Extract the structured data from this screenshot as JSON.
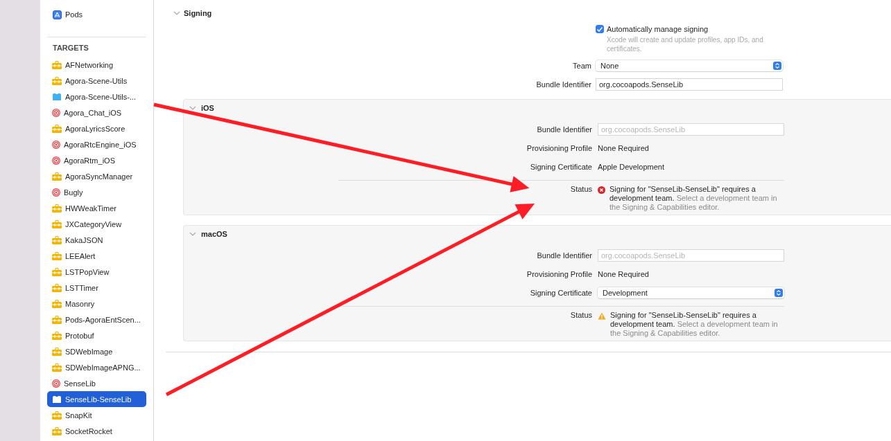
{
  "sidebar": {
    "project": {
      "label": "Pods"
    },
    "section_title": "TARGETS",
    "items": [
      {
        "label": "AFNetworking",
        "kind": "toolbox",
        "selected": false
      },
      {
        "label": "Agora-Scene-Utils",
        "kind": "toolbox",
        "selected": false
      },
      {
        "label": "Agora-Scene-Utils-...",
        "kind": "bundle",
        "selected": false
      },
      {
        "label": "Agora_Chat_iOS",
        "kind": "target",
        "selected": false
      },
      {
        "label": "AgoraLyricsScore",
        "kind": "toolbox",
        "selected": false
      },
      {
        "label": "AgoraRtcEngine_iOS",
        "kind": "target",
        "selected": false
      },
      {
        "label": "AgoraRtm_iOS",
        "kind": "target",
        "selected": false
      },
      {
        "label": "AgoraSyncManager",
        "kind": "toolbox",
        "selected": false
      },
      {
        "label": "Bugly",
        "kind": "target",
        "selected": false
      },
      {
        "label": "HWWeakTimer",
        "kind": "toolbox",
        "selected": false
      },
      {
        "label": "JXCategoryView",
        "kind": "toolbox",
        "selected": false
      },
      {
        "label": "KakaJSON",
        "kind": "toolbox",
        "selected": false
      },
      {
        "label": "LEEAlert",
        "kind": "toolbox",
        "selected": false
      },
      {
        "label": "LSTPopView",
        "kind": "toolbox",
        "selected": false
      },
      {
        "label": "LSTTimer",
        "kind": "toolbox",
        "selected": false
      },
      {
        "label": "Masonry",
        "kind": "toolbox",
        "selected": false
      },
      {
        "label": "Pods-AgoraEntScen...",
        "kind": "toolbox",
        "selected": false
      },
      {
        "label": "Protobuf",
        "kind": "toolbox",
        "selected": false
      },
      {
        "label": "SDWebImage",
        "kind": "toolbox",
        "selected": false
      },
      {
        "label": "SDWebImageAPNG...",
        "kind": "toolbox",
        "selected": false
      },
      {
        "label": "SenseLib",
        "kind": "target",
        "selected": false
      },
      {
        "label": "SenseLib-SenseLib",
        "kind": "bundle",
        "selected": true
      },
      {
        "label": "SnapKit",
        "kind": "toolbox",
        "selected": false
      },
      {
        "label": "SocketRocket",
        "kind": "toolbox",
        "selected": false
      }
    ]
  },
  "signing": {
    "title": "Signing",
    "expanded": true,
    "auto_manage": {
      "label": "Automatically manage signing",
      "checked": true,
      "hint": "Xcode will create and update profiles, app IDs, and certificates."
    },
    "rows": [
      {
        "kind": "popup",
        "label": "Team",
        "value": "None"
      },
      {
        "kind": "field",
        "label": "Bundle Identifier",
        "value": "org.cocoapods.SenseLib"
      }
    ],
    "platforms": [
      {
        "title": "iOS",
        "expanded": true,
        "rows": [
          {
            "kind": "field",
            "label": "Bundle Identifier",
            "placeholder": "org.cocoapods.SenseLib"
          },
          {
            "kind": "text",
            "label": "Provisioning Profile",
            "value": "None Required"
          },
          {
            "kind": "text",
            "label": "Signing Certificate",
            "value": "Apple Development"
          },
          {
            "kind": "status",
            "label": "Status",
            "error": true,
            "message": "Signing for \"SenseLib-SenseLib\" requires a development team.",
            "hint": "Select a development team in the Signing & Capabilities editor."
          }
        ]
      },
      {
        "title": "macOS",
        "expanded": true,
        "rows": [
          {
            "kind": "field",
            "label": "Bundle Identifier",
            "placeholder": "org.cocoapods.SenseLib"
          },
          {
            "kind": "text",
            "label": "Provisioning Profile",
            "value": "None Required"
          },
          {
            "kind": "popup",
            "label": "Signing Certificate",
            "value": "Development"
          },
          {
            "kind": "status",
            "label": "Status",
            "error": false,
            "message": "Signing for \"SenseLib-SenseLib\" requires a development team.",
            "hint": "Select a development team in the Signing & Capabilities editor."
          }
        ]
      }
    ]
  }
}
